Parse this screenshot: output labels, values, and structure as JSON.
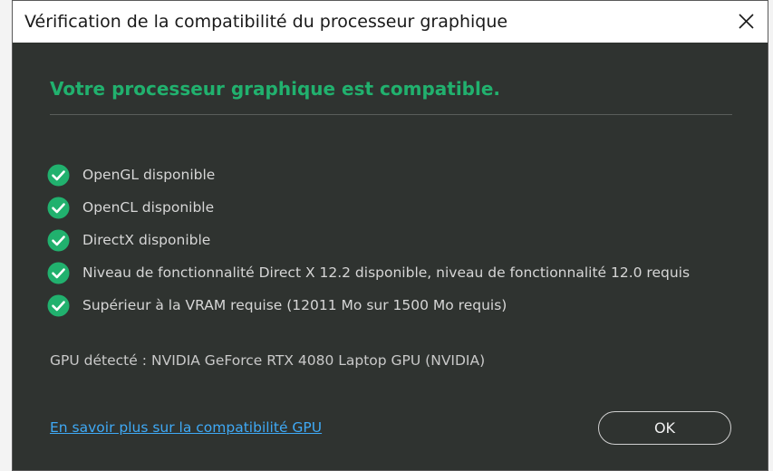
{
  "window": {
    "title": "Vérification de la compatibilité du processeur graphique"
  },
  "headline": "Votre processeur graphique est compatible.",
  "checks": [
    {
      "label": "OpenGL disponible",
      "status": "ok"
    },
    {
      "label": "OpenCL disponible",
      "status": "ok"
    },
    {
      "label": "DirectX disponible",
      "status": "ok"
    },
    {
      "label": "Niveau de fonctionnalité Direct X 12.2 disponible, niveau de fonctionnalité 12.0 requis",
      "status": "ok"
    },
    {
      "label": "Supérieur à la VRAM requise (12011 Mo sur 1500 Mo requis)",
      "status": "ok"
    }
  ],
  "gpu": {
    "label": "GPU détecté",
    "separator": ":",
    "value": "NVIDIA GeForce RTX 4080 Laptop GPU (NVIDIA)"
  },
  "link_text": "En savoir plus sur la compatibilité GPU",
  "ok_label": "OK",
  "colors": {
    "accent_green": "#21b16e",
    "link_blue": "#3fa9f5",
    "dialog_bg": "#2f3330"
  },
  "icons": {
    "close": "close-icon",
    "check": "check-circle-icon"
  }
}
